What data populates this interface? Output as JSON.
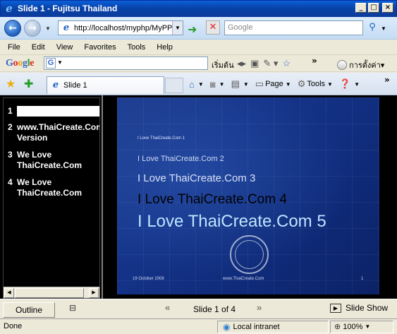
{
  "window": {
    "title": "Slide 1 - Fujitsu Thailand",
    "min_label": "_",
    "max_label": "□",
    "close_label": "×"
  },
  "address_bar": {
    "url": "http://localhost/myphp/MyPP",
    "search_placeholder": "Google"
  },
  "menu": [
    "File",
    "Edit",
    "View",
    "Favorites",
    "Tools",
    "Help"
  ],
  "google_toolbar": {
    "logo": [
      "G",
      "o",
      "o",
      "g",
      "l",
      "e"
    ],
    "start_label": "เริ่มต้น",
    "settings_label": "การตั้งค่า"
  },
  "tabbar": {
    "tab_label": "Slide 1",
    "page_label": "Page",
    "tools_label": "Tools"
  },
  "outline": {
    "items": [
      {
        "num": "1",
        "text": ""
      },
      {
        "num": "2",
        "text": "www.ThaiCreate.Com Version"
      },
      {
        "num": "3",
        "text": "We Love ThaiCreate.Com"
      },
      {
        "num": "4",
        "text": "We Love ThaiCreate.Com"
      }
    ]
  },
  "slide": {
    "lines": [
      "I Love ThaiCreate.Com 1",
      "I Love ThaiCreate.Com 2",
      "I Love ThaiCreate.Com 3",
      "I Love ThaiCreate.Com 4",
      "I Love ThaiCreate.Com 5"
    ],
    "footer_date": "19 October 2008",
    "footer_site": "www.ThaiCreate.Com",
    "footer_page": "1"
  },
  "controls": {
    "outline_label": "Outline",
    "counter": "Slide 1 of 4",
    "slideshow_label": "Slide Show"
  },
  "status": {
    "text": "Done",
    "zone": "Local intranet",
    "zoom": "100%"
  }
}
